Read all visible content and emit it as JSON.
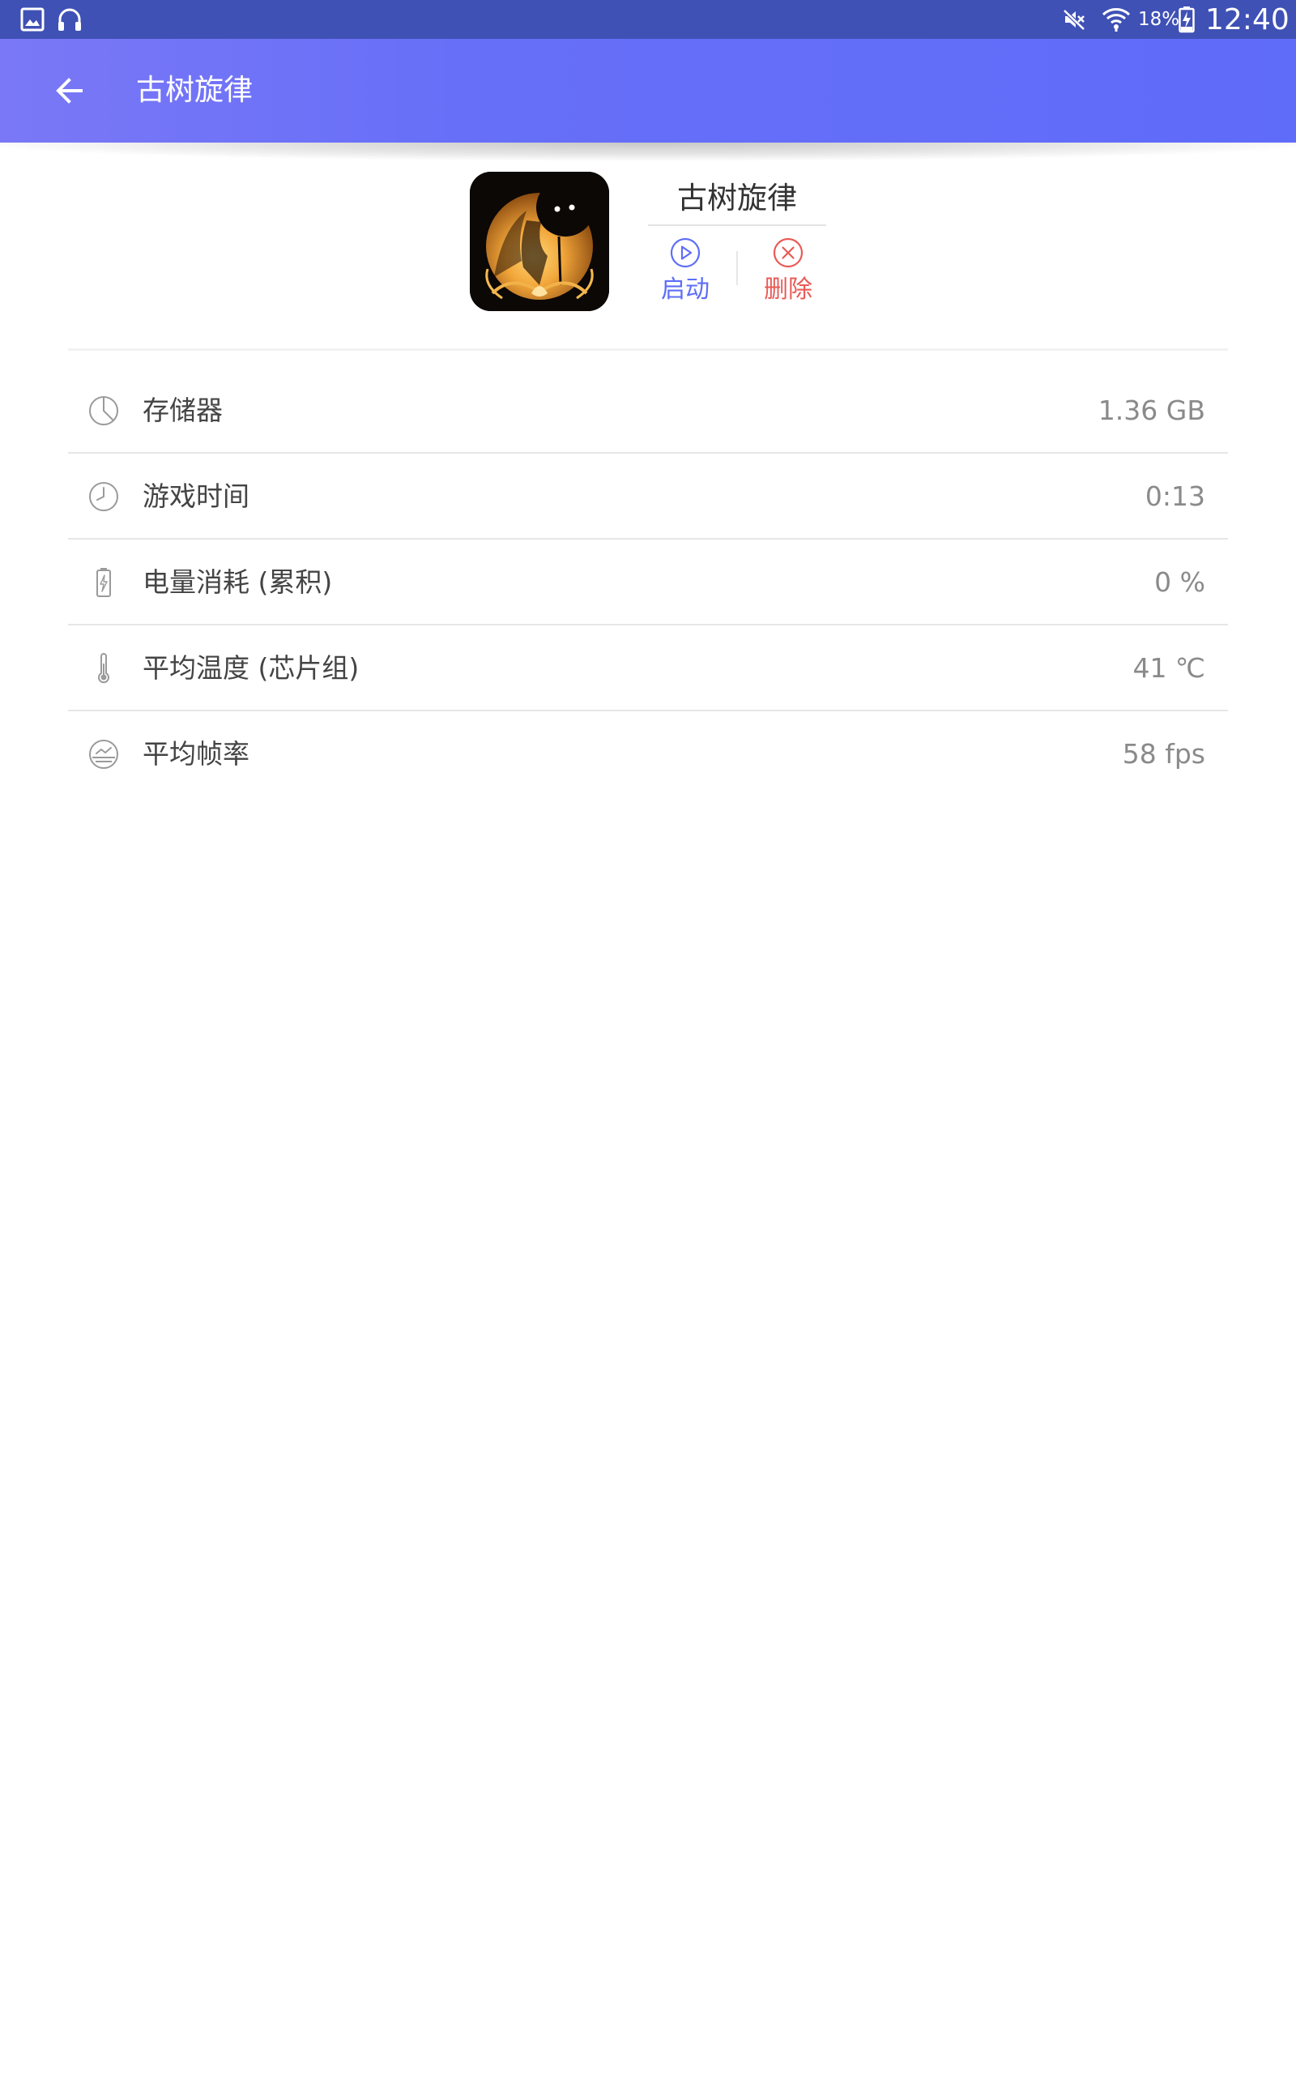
{
  "colors": {
    "status_bar": "#3f51b5",
    "app_bar_start": "#7a78f6",
    "app_bar_end": "#5f6cf9",
    "launch_accent": "#5e6ef8",
    "delete_accent": "#ea5a55",
    "divider": "#e6e6e6"
  },
  "status_bar": {
    "left_icons": [
      "gallery-icon",
      "headphones-icon"
    ],
    "right_icons": [
      "mute-icon",
      "wifi-icon",
      "battery-charging-icon"
    ],
    "battery_percent": "18%",
    "time": "12:40"
  },
  "app_bar": {
    "back_icon": "arrow-left-icon",
    "title": "古树旋律"
  },
  "app": {
    "icon": "game-app-icon",
    "name": "古树旋律",
    "actions": {
      "launch": {
        "icon": "play-circle-icon",
        "label": "启动"
      },
      "delete": {
        "icon": "close-circle-icon",
        "label": "删除"
      }
    }
  },
  "stats": [
    {
      "icon": "pie-chart-icon",
      "label": "存储器",
      "value": "1.36 GB"
    },
    {
      "icon": "clock-icon",
      "label": "游戏时间",
      "value": "0:13"
    },
    {
      "icon": "battery-icon",
      "label": "电量消耗 (累积)",
      "value": "0 %"
    },
    {
      "icon": "thermometer-icon",
      "label": "平均温度 (芯片组)",
      "value": "41 ℃"
    },
    {
      "icon": "frame-rate-icon",
      "label": "平均帧率",
      "value": "58 fps"
    }
  ]
}
